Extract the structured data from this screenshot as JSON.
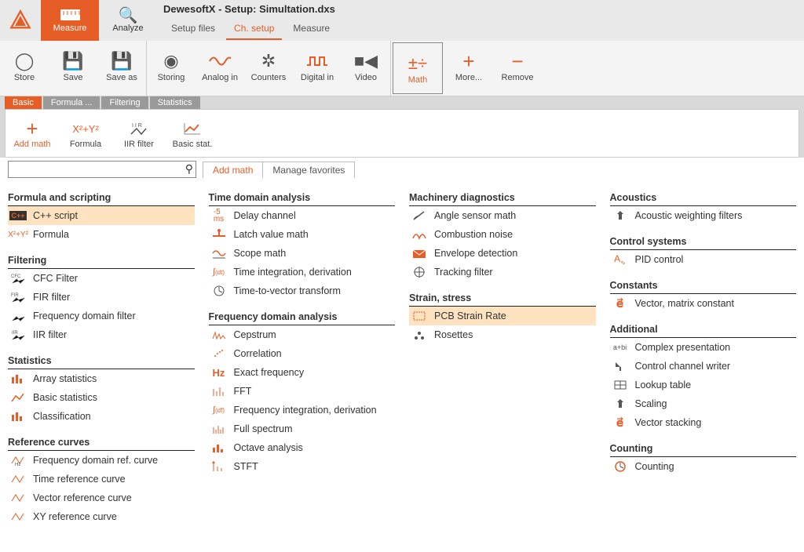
{
  "app": {
    "title": "DewesoftX - Setup: Simultation.dxs"
  },
  "modes": {
    "measure": "Measure",
    "analyze": "Analyze"
  },
  "submenu": {
    "setup_files": "Setup files",
    "ch_setup": "Ch. setup",
    "measure": "Measure"
  },
  "toolbar": {
    "store": "Store",
    "save": "Save",
    "saveas": "Save as",
    "storing": "Storing",
    "analogin": "Analog in",
    "counters": "Counters",
    "digitalin": "Digital in",
    "video": "Video",
    "math": "Math",
    "more": "More...",
    "remove": "Remove"
  },
  "minitabs": {
    "basic": "Basic",
    "formula": "Formula ...",
    "filtering": "Filtering",
    "statistics": "Statistics"
  },
  "ribbon": {
    "addmath": "Add math",
    "formula": "Formula",
    "iir": "IIR filter",
    "basicstat": "Basic stat."
  },
  "search": {
    "placeholder": ""
  },
  "page_tabs": {
    "addmath": "Add math",
    "favorites": "Manage favorites"
  },
  "categories": {
    "col1": [
      {
        "head": "Formula and scripting",
        "items": [
          {
            "icon": "C++",
            "label": "C++ script",
            "hl": true
          },
          {
            "icon": "xy",
            "label": "Formula"
          }
        ]
      },
      {
        "head": "Filtering",
        "items": [
          {
            "icon": "cfc",
            "label": "CFC Filter"
          },
          {
            "icon": "fir",
            "label": "FIR filter"
          },
          {
            "icon": "fdf",
            "label": "Frequency domain filter"
          },
          {
            "icon": "iir",
            "label": "IIR filter"
          }
        ]
      },
      {
        "head": "Statistics",
        "items": [
          {
            "icon": "arr",
            "label": "Array statistics"
          },
          {
            "icon": "bas",
            "label": "Basic statistics"
          },
          {
            "icon": "cls",
            "label": "Classification"
          }
        ]
      },
      {
        "head": "Reference curves",
        "items": [
          {
            "icon": "frc",
            "label": "Frequency domain ref. curve"
          },
          {
            "icon": "trc",
            "label": "Time reference curve"
          },
          {
            "icon": "vrc",
            "label": "Vector reference curve"
          },
          {
            "icon": "xrc",
            "label": "XY reference curve"
          }
        ]
      }
    ],
    "col2": [
      {
        "head": "Time domain analysis",
        "items": [
          {
            "icon": "dly",
            "label": "Delay channel"
          },
          {
            "icon": "lvm",
            "label": "Latch value math"
          },
          {
            "icon": "scp",
            "label": "Scope math"
          },
          {
            "icon": "tid",
            "label": "Time integration, derivation"
          },
          {
            "icon": "ttv",
            "label": "Time-to-vector transform"
          }
        ]
      },
      {
        "head": "Frequency domain analysis",
        "items": [
          {
            "icon": "cep",
            "label": "Cepstrum"
          },
          {
            "icon": "cor",
            "label": "Correlation"
          },
          {
            "icon": "hz",
            "label": "Exact frequency"
          },
          {
            "icon": "fft",
            "label": "FFT"
          },
          {
            "icon": "fid",
            "label": "Frequency integration, derivation"
          },
          {
            "icon": "fsp",
            "label": "Full spectrum"
          },
          {
            "icon": "oct",
            "label": "Octave analysis"
          },
          {
            "icon": "stf",
            "label": "STFT"
          }
        ]
      }
    ],
    "col3": [
      {
        "head": "Machinery diagnostics",
        "items": [
          {
            "icon": "ang",
            "label": "Angle sensor math"
          },
          {
            "icon": "cmb",
            "label": "Combustion noise"
          },
          {
            "icon": "env",
            "label": "Envelope detection"
          },
          {
            "icon": "trk",
            "label": "Tracking filter"
          }
        ]
      },
      {
        "head": "Strain, stress",
        "items": [
          {
            "icon": "pcb",
            "label": "PCB Strain Rate",
            "hl": true
          },
          {
            "icon": "ros",
            "label": "Rosettes"
          }
        ]
      }
    ],
    "col4": [
      {
        "head": "Acoustics",
        "items": [
          {
            "icon": "awf",
            "label": "Acoustic weighting filters"
          }
        ]
      },
      {
        "head": "Control systems",
        "items": [
          {
            "icon": "pid",
            "label": "PID control"
          }
        ]
      },
      {
        "head": "Constants",
        "items": [
          {
            "icon": "vec",
            "label": "Vector, matrix constant"
          }
        ]
      },
      {
        "head": "Additional",
        "items": [
          {
            "icon": "cpx",
            "label": "Complex presentation"
          },
          {
            "icon": "ccw",
            "label": "Control channel writer"
          },
          {
            "icon": "lut",
            "label": "Lookup table"
          },
          {
            "icon": "scl",
            "label": "Scaling"
          },
          {
            "icon": "vst",
            "label": "Vector stacking"
          }
        ]
      },
      {
        "head": "Counting",
        "items": [
          {
            "icon": "cnt",
            "label": "Counting"
          }
        ]
      }
    ]
  }
}
